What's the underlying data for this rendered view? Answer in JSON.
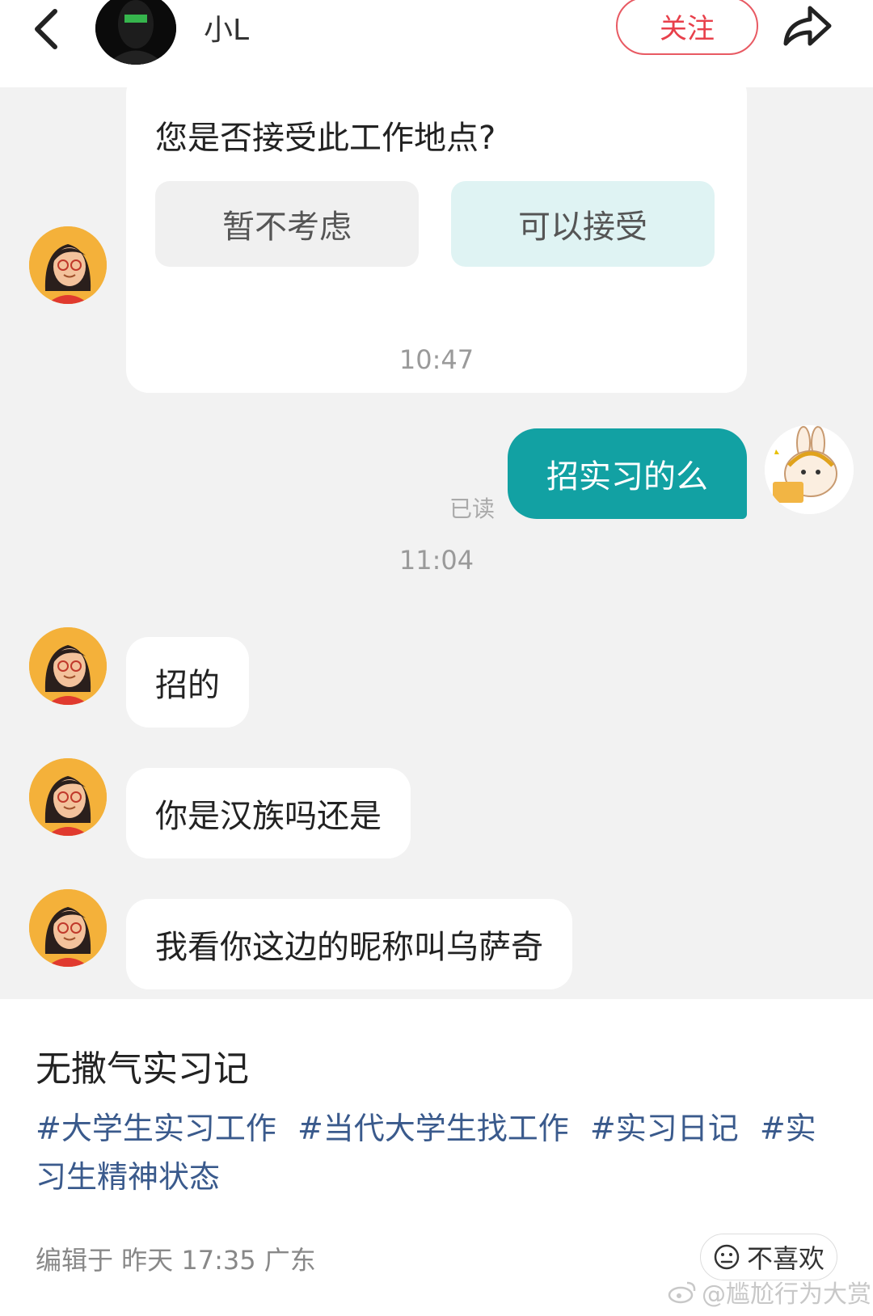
{
  "header": {
    "author_name": "小L",
    "follow_label": "关注"
  },
  "chat": {
    "card": {
      "question": "您是否接受此工作地点?",
      "option_decline": "暂不考虑",
      "option_accept": "可以接受"
    },
    "time_1": "10:47",
    "my_message": "招实习的么",
    "read_status": "已读",
    "time_2": "11:04",
    "replies": [
      "招的",
      "你是汉族吗还是",
      "我看你这边的昵称叫乌萨奇"
    ]
  },
  "post": {
    "title": "无撒气实习记",
    "tags": [
      "#大学生实习工作",
      "#当代大学生找工作",
      "#实习日记",
      "#实习生精神状态"
    ],
    "edit_info": "编辑于 昨天 17:35 广东",
    "dislike_label": "不喜欢",
    "watermark": "@尴尬行为大赏"
  },
  "colors": {
    "accent_teal": "#12a1a3",
    "follow_red": "#e8404b",
    "tag_blue": "#3a5a8c"
  }
}
